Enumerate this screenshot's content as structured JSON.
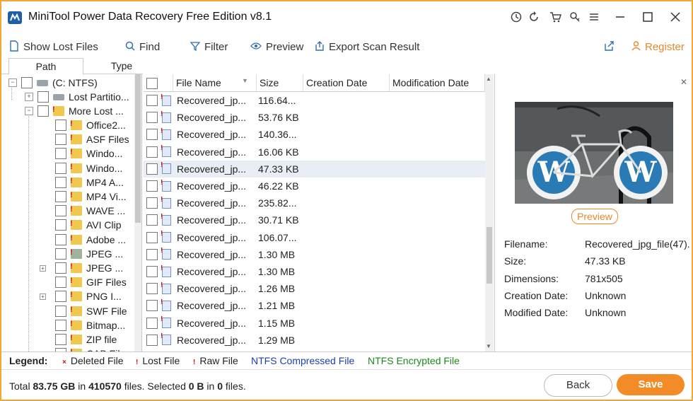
{
  "window": {
    "title": "MiniTool Power Data Recovery Free Edition v8.1",
    "controls": [
      "minimize",
      "maximize",
      "close"
    ]
  },
  "title_icons": [
    "clock-icon",
    "refresh-icon",
    "cart-icon",
    "key-icon",
    "menu-icon"
  ],
  "toolbar": {
    "show_lost_files": "Show Lost Files",
    "find": "Find",
    "filter": "Filter",
    "preview": "Preview",
    "export": "Export Scan Result",
    "register": "Register"
  },
  "tree_tabs": [
    "Path",
    "Type"
  ],
  "tree": {
    "root": "(C: NTFS)",
    "lost_partition": "Lost Partitio...",
    "more_lost": "More Lost ...",
    "items": [
      {
        "label": "Office2...",
        "icon": "raw"
      },
      {
        "label": "ASF Files",
        "icon": "raw"
      },
      {
        "label": "Windo...",
        "icon": "raw"
      },
      {
        "label": "Windo...",
        "icon": "raw"
      },
      {
        "label": "MP4 A...",
        "icon": "raw"
      },
      {
        "label": "MP4 Vi...",
        "icon": "raw"
      },
      {
        "label": "WAVE ...",
        "icon": "raw"
      },
      {
        "label": "AVI Clip",
        "icon": "raw"
      },
      {
        "label": "Adobe ...",
        "icon": "raw"
      },
      {
        "label": "JPEG ...",
        "icon": "selected"
      },
      {
        "label": "JPEG ...",
        "icon": "raw",
        "expandable": true
      },
      {
        "label": "GIF Files",
        "icon": "raw"
      },
      {
        "label": "PNG I...",
        "icon": "raw",
        "expandable": true
      },
      {
        "label": "SWF File",
        "icon": "raw"
      },
      {
        "label": "Bitmap...",
        "icon": "raw"
      },
      {
        "label": "ZIP file",
        "icon": "raw"
      },
      {
        "label": "CAB File",
        "icon": "raw"
      }
    ]
  },
  "columns": [
    "File Name",
    "Size",
    "Creation Date",
    "Modification Date"
  ],
  "files": [
    {
      "name": "Recovered_jp...",
      "size": "116.64..."
    },
    {
      "name": "Recovered_jp...",
      "size": "53.76 KB"
    },
    {
      "name": "Recovered_jp...",
      "size": "140.36..."
    },
    {
      "name": "Recovered_jp...",
      "size": "16.06 KB"
    },
    {
      "name": "Recovered_jp...",
      "size": "47.33 KB",
      "selected": true
    },
    {
      "name": "Recovered_jp...",
      "size": "46.22 KB"
    },
    {
      "name": "Recovered_jp...",
      "size": "235.82..."
    },
    {
      "name": "Recovered_jp...",
      "size": "30.71 KB"
    },
    {
      "name": "Recovered_jp...",
      "size": "106.07..."
    },
    {
      "name": "Recovered_jp...",
      "size": "1.30 MB"
    },
    {
      "name": "Recovered_jp...",
      "size": "1.30 MB"
    },
    {
      "name": "Recovered_jp...",
      "size": "1.26 MB"
    },
    {
      "name": "Recovered_jp...",
      "size": "1.21 MB"
    },
    {
      "name": "Recovered_jp...",
      "size": "1.15 MB"
    },
    {
      "name": "Recovered_jp...",
      "size": "1.29 MB"
    }
  ],
  "preview": {
    "button": "Preview",
    "info": [
      {
        "label": "Filename:",
        "value": "Recovered_jpg_file(47)."
      },
      {
        "label": "Size:",
        "value": "47.33 KB"
      },
      {
        "label": "Dimensions:",
        "value": "781x505"
      },
      {
        "label": "Creation Date:",
        "value": "Unknown"
      },
      {
        "label": "Modified Date:",
        "value": "Unknown"
      }
    ]
  },
  "legend": {
    "title": "Legend:",
    "deleted": "Deleted File",
    "lost": "Lost File",
    "raw": "Raw File",
    "ntfs_compressed": "NTFS Compressed File",
    "ntfs_encrypted": "NTFS Encrypted File",
    "colors": {
      "compressed": "#1a3fb0",
      "encrypted": "#1a8a1a",
      "marker": "#d01010"
    }
  },
  "status": {
    "prefix": "Total ",
    "total_size": "83.75 GB",
    "mid1": " in ",
    "total_files": "410570",
    "mid2": " files.  Selected ",
    "selected_size": "0 B",
    "mid3": " in ",
    "selected_files": "0",
    "suffix": " files."
  },
  "buttons": {
    "back": "Back",
    "save": "Save"
  },
  "accent_color": "#f28c28"
}
